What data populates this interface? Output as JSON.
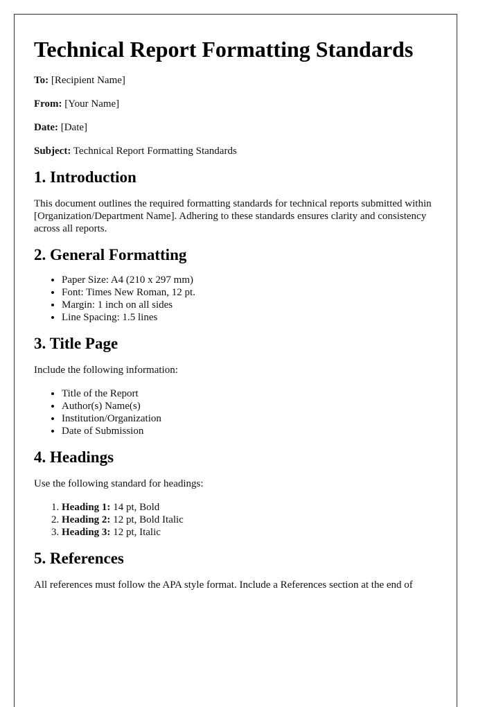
{
  "document": {
    "title": "Technical Report Formatting Standards",
    "memo": [
      {
        "label": "To:",
        "value": "[Recipient Name]"
      },
      {
        "label": "From:",
        "value": "[Your Name]"
      },
      {
        "label": "Date:",
        "value": "[Date]"
      },
      {
        "label": "Subject:",
        "value": "Technical Report Formatting Standards"
      }
    ],
    "sections": {
      "introduction": {
        "heading": "1. Introduction",
        "text": "This document outlines the required formatting standards for technical reports submitted within [Organization/Department Name]. Adhering to these standards ensures clarity and consistency across all reports."
      },
      "general_formatting": {
        "heading": "2. General Formatting",
        "items": [
          "Paper Size: A4 (210 x 297 mm)",
          "Font: Times New Roman, 12 pt.",
          "Margin: 1 inch on all sides",
          "Line Spacing: 1.5 lines"
        ]
      },
      "title_page": {
        "heading": "3. Title Page",
        "intro": "Include the following information:",
        "items": [
          "Title of the Report",
          "Author(s) Name(s)",
          "Institution/Organization",
          "Date of Submission"
        ]
      },
      "headings": {
        "heading": "4. Headings",
        "intro": "Use the following standard for headings:",
        "items": [
          {
            "label": "Heading 1:",
            "value": "14 pt, Bold"
          },
          {
            "label": "Heading 2:",
            "value": "12 pt, Bold Italic"
          },
          {
            "label": "Heading 3:",
            "value": "12 pt, Italic"
          }
        ]
      },
      "references": {
        "heading": "5. References",
        "text": "All references must follow the APA style format. Include a References section at the end of"
      }
    }
  }
}
